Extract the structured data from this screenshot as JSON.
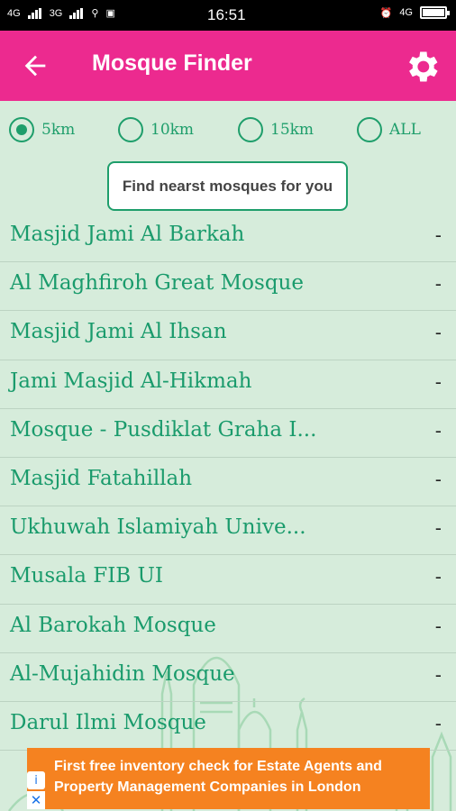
{
  "status_bar": {
    "network_1": "4G",
    "network_2": "3G",
    "time": "16:51",
    "network_right": "4G"
  },
  "app_bar": {
    "title": "Mosque Finder"
  },
  "radius_options": [
    {
      "label": "5km",
      "checked": true
    },
    {
      "label": "10km",
      "checked": false
    },
    {
      "label": "15km",
      "checked": false
    },
    {
      "label": "ALL",
      "checked": false
    }
  ],
  "find_button": "Find nearst mosques for you",
  "mosques": [
    {
      "name": "Masjid Jami Al Barkah",
      "distance": "-"
    },
    {
      "name": "Al Maghfiroh Great Mosque",
      "distance": "-"
    },
    {
      "name": "Masjid Jami Al Ihsan",
      "distance": "-"
    },
    {
      "name": "Jami Masjid Al-Hikmah",
      "distance": "-"
    },
    {
      "name": "Mosque - Pusdiklat Graha I...",
      "distance": "-"
    },
    {
      "name": "Masjid Fatahillah",
      "distance": "-"
    },
    {
      "name": "Ukhuwah Islamiyah Unive...",
      "distance": "-"
    },
    {
      "name": "Musala FIB UI",
      "distance": "-"
    },
    {
      "name": "Al Barokah Mosque",
      "distance": "-"
    },
    {
      "name": "Al-Mujahidin Mosque",
      "distance": "-"
    },
    {
      "name": "Darul Ilmi Mosque",
      "distance": "-"
    }
  ],
  "ad": {
    "line1": "First free inventory check for Estate Agents and",
    "line2": "Property Management Companies in London",
    "info_icon": "i",
    "close_icon": "✕"
  },
  "colors": {
    "app_bar": "#ec2a8f",
    "accent": "#1e9e6b",
    "background": "#d6ecdb",
    "ad": "#f58220"
  }
}
